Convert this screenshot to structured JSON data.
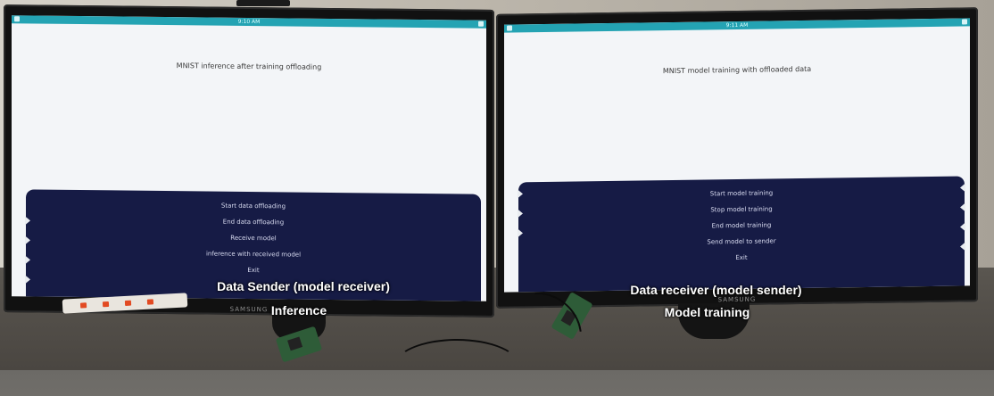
{
  "left_monitor": {
    "status_time": "9:10 AM",
    "title": "MNIST inference after training offloading",
    "brand": "SAMSUNG",
    "menu": [
      "Start data offloading",
      "End data offloading",
      "Receive model",
      "inference with received model",
      "Exit"
    ]
  },
  "right_monitor": {
    "status_time": "9:11 AM",
    "title": "MNIST model training with offloaded data",
    "brand": "SAMSUNG",
    "menu": [
      "Start model training",
      "Stop model training",
      "End model training",
      "Send model to sender",
      "Exit"
    ]
  },
  "captions": {
    "left_line1": "Data Sender (model receiver)",
    "left_line2": "Inference",
    "right_line1": "Data receiver (model sender)",
    "right_line2": "Model training"
  },
  "colors": {
    "status_bar": "#24a3b3",
    "menu_bg": "#161b45",
    "screen_bg": "#f3f5f8"
  }
}
